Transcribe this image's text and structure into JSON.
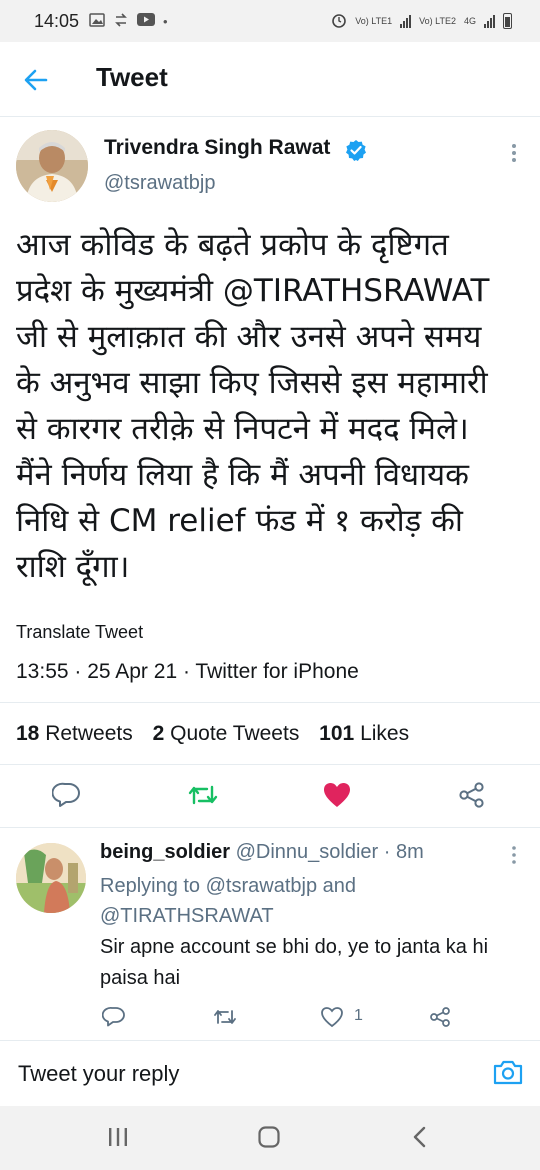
{
  "status_bar": {
    "time": "14:05",
    "sim1": "Vo) LTE1",
    "sim2": "Vo) LTE2",
    "network": "4G"
  },
  "header": {
    "title": "Tweet"
  },
  "tweet": {
    "author_name": "Trivendra Singh Rawat",
    "author_handle": "@tsrawatbjp",
    "text_lines": [
      "आज कोविड के बढ़ते प्रकोप के दृष्टिगत",
      "प्रदेश के मुख्यमंत्री @TIRATHSRAWAT",
      "जी से मुलाक़ात की और उनसे अपने समय",
      "के अनुभव साझा किए जिससे इस महामारी",
      "से कारगर तरीक़े से निपटने में मदद मिले।",
      "मैंने निर्णय लिया है कि मैं अपनी विधायक",
      "निधि से CM relief फंड में १ करोड़ की",
      "राशि दूँगा।"
    ],
    "translate_label": "Translate Tweet",
    "meta": "13:55 · 25 Apr 21 · Twitter for iPhone",
    "retweets_count": "18",
    "retweets_label": "Retweets",
    "quote_count": "2",
    "quote_label": "Quote Tweets",
    "likes_count": "101",
    "likes_label": "Likes",
    "liked_color": "#e0245e",
    "retweet_color": "#17bf63"
  },
  "reply": {
    "name": "being_soldier",
    "handle": "@Dinnu_soldier",
    "time": "· 8m",
    "replying_prefix": "Replying to",
    "replying_mention1": "@tsrawatbjp",
    "replying_and": "and",
    "replying_mention2": "@TIRATHSRAWAT",
    "text": "Sir apne account se bhi do, ye to janta ka hi paisa hai",
    "like_count": "1"
  },
  "reply_bar": {
    "placeholder": "Tweet your reply"
  },
  "icons": {
    "back": "arrow-left-icon",
    "verified": "verified-badge-icon",
    "more": "more-vertical-icon",
    "reply": "comment-icon",
    "retweet": "retweet-icon",
    "like": "heart-icon",
    "share": "share-icon",
    "camera": "camera-icon"
  },
  "colors": {
    "accent": "#1da1f2",
    "secondary_text": "#5b7083"
  }
}
